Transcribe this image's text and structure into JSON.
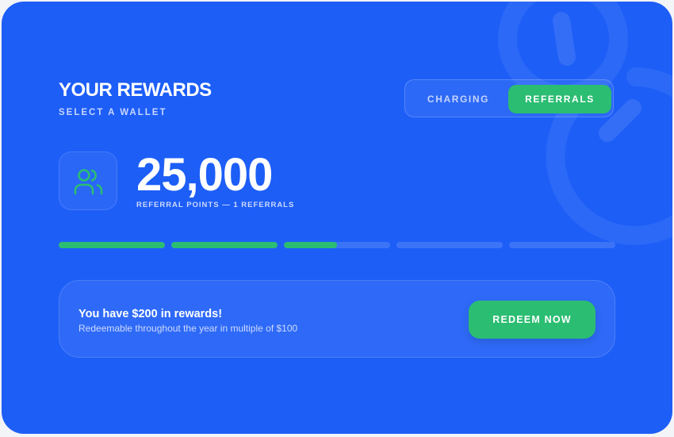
{
  "header": {
    "title": "YOUR REWARDS",
    "subtitle": "SELECT A WALLET"
  },
  "tabs": [
    {
      "label": "CHARGING",
      "selected": false
    },
    {
      "label": "REFERRALS",
      "selected": true
    }
  ],
  "points": {
    "value": "25,000",
    "caption": "REFERRAL POINTS — 1 REFERRALS",
    "icon": "users-icon"
  },
  "progress": {
    "segments": [
      1,
      1,
      0.5,
      0,
      0
    ]
  },
  "rewards": {
    "title": "You have $200 in rewards!",
    "description": "Redeemable throughout the year in multiple of $100",
    "button_label": "REDEEM NOW"
  },
  "colors": {
    "background": "#1d5ef7",
    "accent": "#2bbd72"
  }
}
